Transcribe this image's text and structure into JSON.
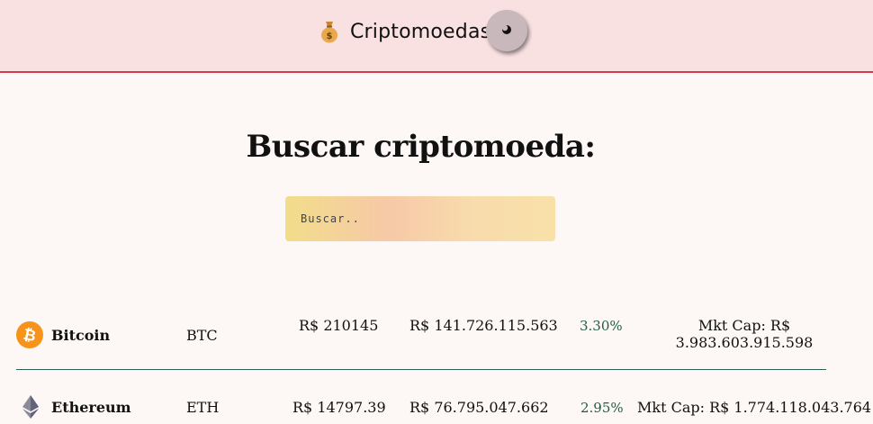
{
  "header": {
    "title": "Criptomoedas",
    "brand_icon": "money-bag-icon",
    "toggle_icon": "moon-icon"
  },
  "main": {
    "title": "Buscar criptomoeda:",
    "search": {
      "placeholder": "Buscar..",
      "value": ""
    }
  },
  "coins": [
    {
      "name": "Bitcoin",
      "symbol": "BTC",
      "price": "R$ 210145",
      "volume": "R$ 141.726.115.563",
      "change": "3.30%",
      "market_cap_line1": "Mkt Cap: R$",
      "market_cap_line2": "3.983.603.915.598",
      "icon": "bitcoin-icon"
    },
    {
      "name": "Ethereum",
      "symbol": "ETH",
      "price": "R$ 14797.39",
      "volume": "R$ 76.795.047.662",
      "change": "2.95%",
      "market_cap": "Mkt Cap: R$ 1.774.118.043.764",
      "icon": "ethereum-icon"
    }
  ],
  "colors": {
    "header_bg": "#f9e0e1",
    "header_border": "#d6384f",
    "page_bg": "#fdf7f6",
    "positive_change": "#1f5f45",
    "divider": "#2f5f56"
  }
}
